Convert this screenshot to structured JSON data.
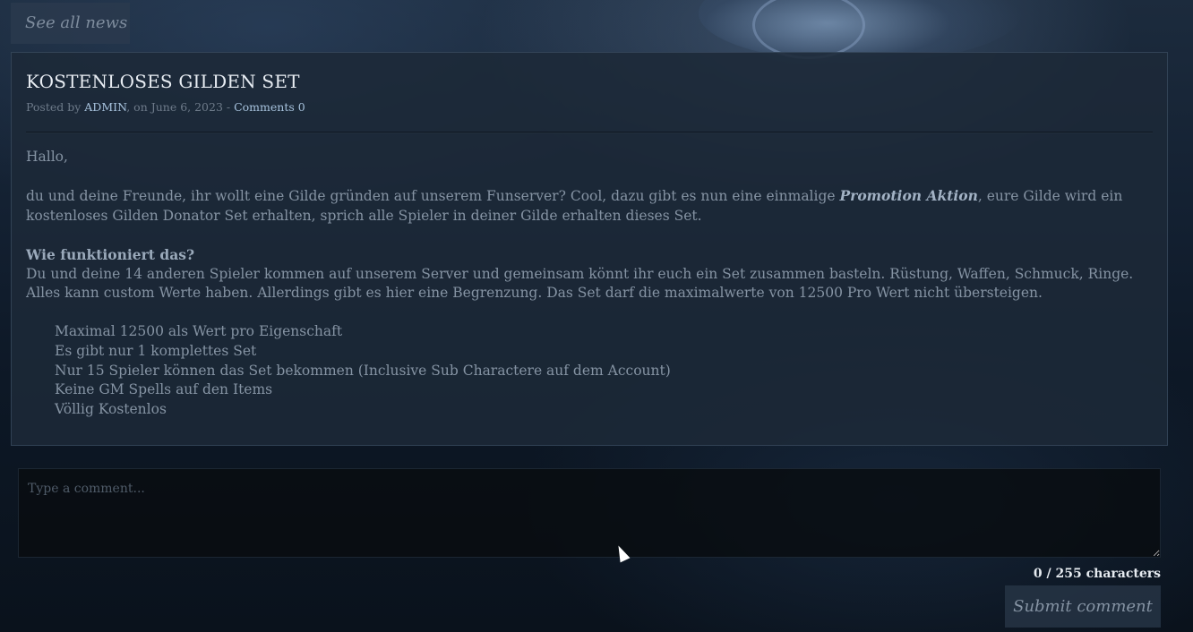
{
  "nav": {
    "see_all_label": "See all news"
  },
  "article": {
    "title": "KOSTENLOSES GILDEN SET",
    "meta": {
      "posted_by_prefix": "Posted by ",
      "author": "ADMIN",
      "date_text": ", on June 6, 2023 - ",
      "comments_label": "Comments 0"
    },
    "greeting": "Hallo,",
    "intro_before": "du und deine Freunde, ihr wollt eine Gilde gründen auf unserem Funserver? Cool, dazu gibt es nun eine einmalige ",
    "intro_promo": "Promotion Aktion",
    "intro_after": ", eure Gilde wird ein kostenloses Gilden Donator Set erhalten, sprich alle Spieler in deiner Gilde erhalten dieses Set.",
    "how_heading": "Wie funktioniert das?",
    "how_text": "Du und deine 14 anderen Spieler kommen auf unserem Server und gemeinsam könnt ihr euch ein Set zusammen basteln. Rüstung, Waffen, Schmuck, Ringe. Alles kann custom Werte haben. Allerdings gibt es hier eine Begrenzung. Das Set darf die maximalwerte von 12500 Pro Wert nicht übersteigen.",
    "rules": [
      "Maximal 12500 als Wert pro Eigenschaft",
      "Es gibt nur 1 komplettes Set",
      "Nur 15 Spieler können das Set bekommen (Inclusive Sub Charactere auf dem Account)",
      "Keine GM Spells auf den Items",
      "Völlig Kostenlos"
    ]
  },
  "comment_form": {
    "placeholder": "Type a comment...",
    "value": "",
    "char_count": "0 / 255 characters",
    "submit_label": "Submit comment"
  },
  "colors": {
    "accent_link": "#a7c2dd",
    "card_background": "#1d2938",
    "title_text": "#e8edf3"
  }
}
